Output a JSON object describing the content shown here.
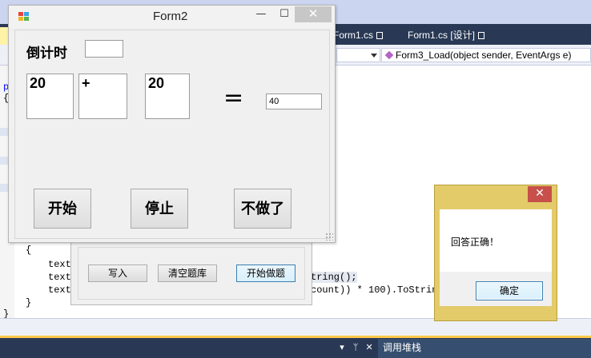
{
  "ide": {
    "tabs": [
      {
        "label": "Form1.cs"
      },
      {
        "label": "Form1.cs [设计]"
      }
    ],
    "method_combo": "Form3_Load(object sender, EventArgs e)",
    "code": {
      "line1": "p",
      "line2": "{",
      "open_brace": "{",
      "text1": "text",
      "text2": "text",
      "text2_tail": "tring();",
      "text3": "text",
      "text3_tail": "count)) * 100).ToStrin",
      "close_brace_inner": "}",
      "close_brace_outer": "}"
    },
    "status": {
      "callstack_label": "调用堆栈",
      "pin_icon": "pin-icon",
      "close_icon": "close-icon"
    }
  },
  "form1": {
    "buttons": {
      "write": "写入",
      "clear_bank": "清空题库",
      "start_quiz": "开始做题"
    }
  },
  "form2": {
    "title": "Form2",
    "countdown_label": "倒计时",
    "countdown_value": "",
    "operand1": "20",
    "operator": "+",
    "operand2": "20",
    "equals": "=",
    "answer": "40",
    "buttons": {
      "start": "开始",
      "stop": "停止",
      "quit": "不做了"
    },
    "controls": {
      "minimize": "—",
      "maximize": "☐",
      "close": "✕"
    }
  },
  "message_box": {
    "text": "回答正确！",
    "ok": "确定",
    "close": "✕"
  },
  "colors": {
    "ide_dark": "#293955",
    "msgbox_frame": "#e3cb6a",
    "close_red": "#c7504a"
  }
}
